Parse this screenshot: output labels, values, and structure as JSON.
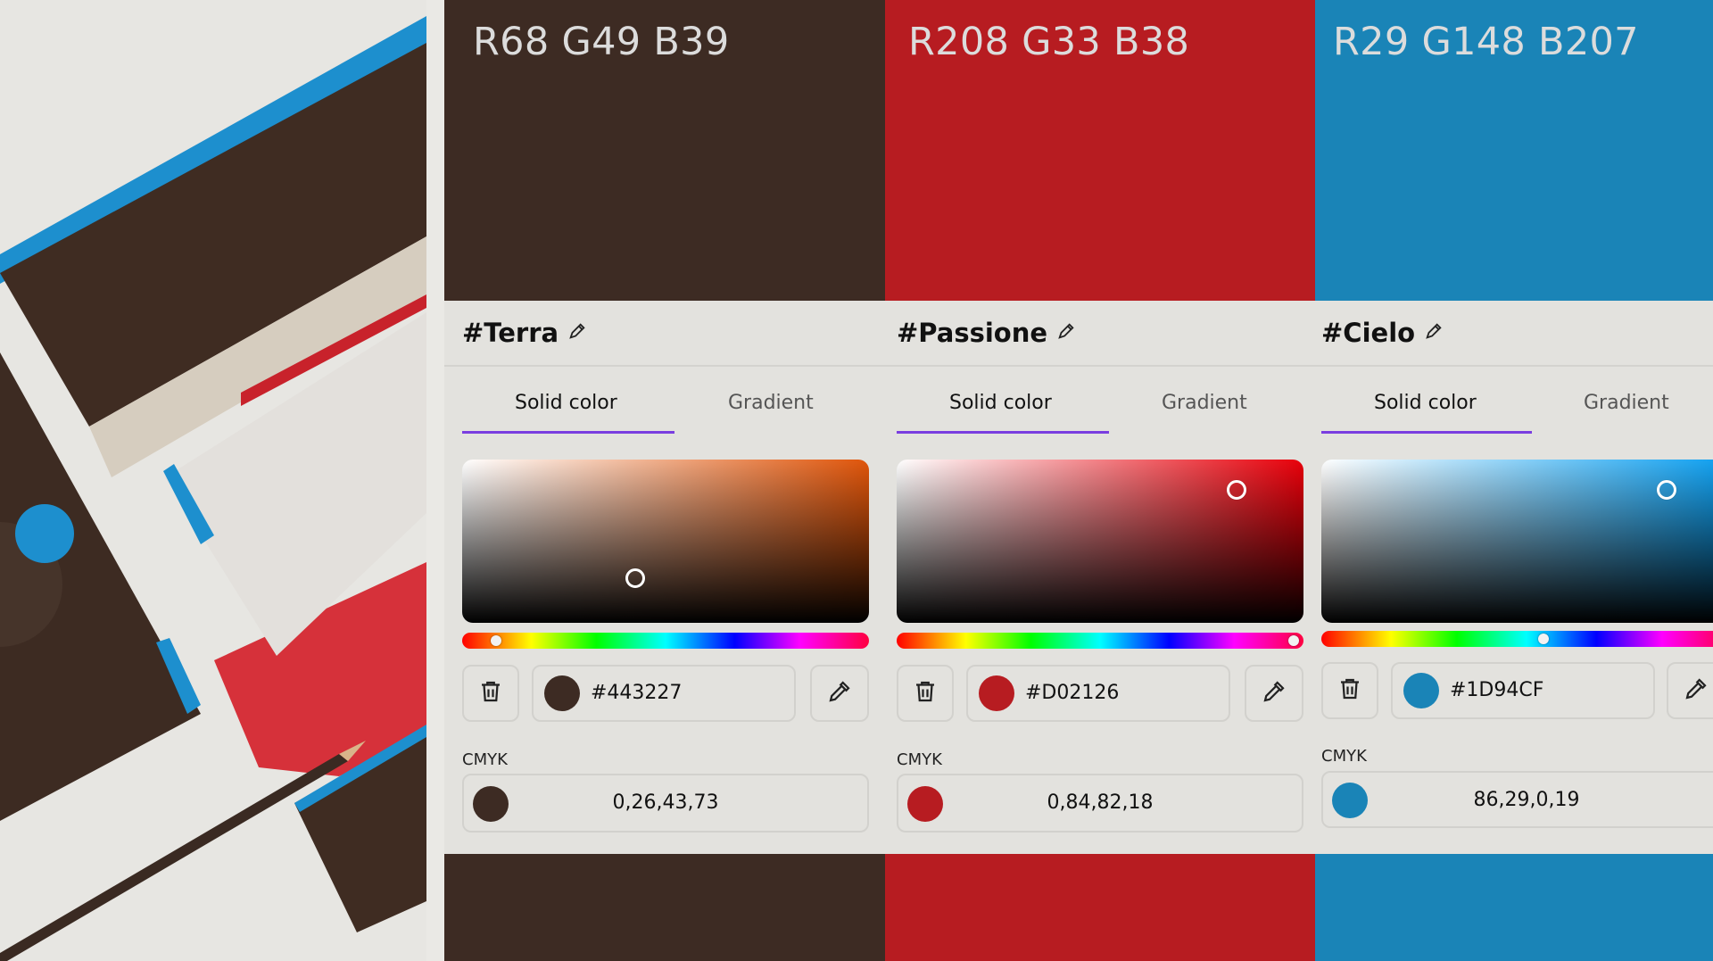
{
  "colors": {
    "terra": "#443227",
    "passione": "#D02126",
    "cielo": "#1D94CF",
    "panel_bg": "#E3E2DE",
    "tab_underline": "#7A3EE0"
  },
  "cards": [
    {
      "rgb_label": "R68 G49 B39",
      "name": "#Terra",
      "tabs": {
        "solid": "Solid color",
        "gradient": "Gradient"
      },
      "hex": "#443227",
      "cmyk_label": "CMYK",
      "cmyk": "0,26,43,73",
      "icons": {
        "edit": "pencil-icon",
        "delete": "trash-icon",
        "picker": "eyedropper-icon"
      }
    },
    {
      "rgb_label": "R208 G33 B38",
      "name": "#Passione",
      "tabs": {
        "solid": "Solid color",
        "gradient": "Gradient"
      },
      "hex": "#D02126",
      "cmyk_label": "CMYK",
      "cmyk": "0,84,82,18",
      "icons": {
        "edit": "pencil-icon",
        "delete": "trash-icon",
        "picker": "eyedropper-icon"
      }
    },
    {
      "rgb_label": "R29 G148 B207",
      "name": "#Cielo",
      "tabs": {
        "solid": "Solid color",
        "gradient": "Gradient"
      },
      "hex": "#1D94CF",
      "cmyk_label": "CMYK",
      "cmyk": "86,29,0,19",
      "icons": {
        "edit": "pencil-icon",
        "delete": "trash-icon",
        "picker": "eyedropper-icon"
      }
    }
  ]
}
